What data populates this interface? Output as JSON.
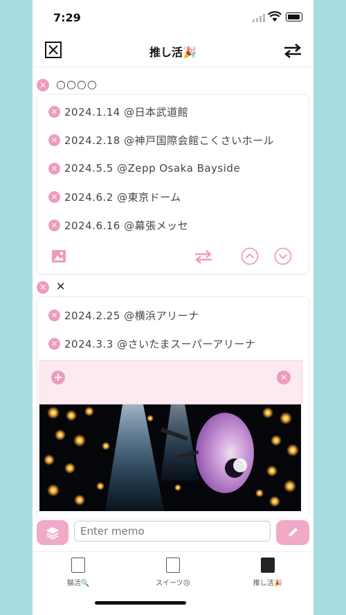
{
  "status": {
    "time": "7:29"
  },
  "nav": {
    "title": "推し活🎉"
  },
  "groups": [
    {
      "title": "○○○○",
      "events": [
        "2024.1.14 @日本武道館",
        "2024.2.18 @神戸国際会館こくさいホール",
        "2024.5.5 @Zepp Osaka Bayside",
        "2024.6.2 @東京ドーム",
        "2024.6.16 @幕張メッセ"
      ]
    },
    {
      "title": "✕ ✕ ✕ ✕",
      "events": [
        "2024.2.25 @横浜アリーナ",
        "2024.3.3 @さいたまスーパーアリーナ"
      ]
    }
  ],
  "memo": {
    "placeholder": "Enter memo"
  },
  "tabs": [
    {
      "label": "猫活🔍"
    },
    {
      "label": "スイーツ😣"
    },
    {
      "label": "推し活🎉"
    }
  ],
  "colors": {
    "accent": "#ef9bc0",
    "background": "#a9dce0"
  }
}
